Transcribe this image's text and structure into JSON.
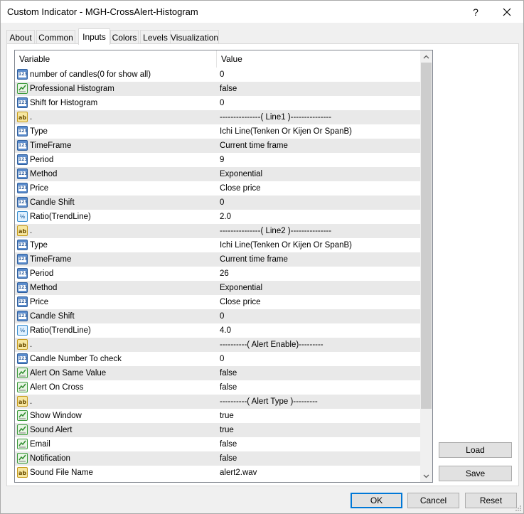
{
  "window": {
    "title": "Custom Indicator - MGH-CrossAlert-Histogram",
    "help_label": "?",
    "icons": {
      "help": "help-icon",
      "close": "close-icon"
    }
  },
  "tabs": [
    {
      "label": "About",
      "active": false
    },
    {
      "label": "Common",
      "active": false
    },
    {
      "label": "Inputs",
      "active": true
    },
    {
      "label": "Colors",
      "active": false
    },
    {
      "label": "Levels",
      "active": false
    },
    {
      "label": "Visualization",
      "active": false
    }
  ],
  "grid": {
    "headers": {
      "variable": "Variable",
      "value": "Value"
    },
    "rows": [
      {
        "type": "num",
        "variable": "number of candles(0 for show all)",
        "value": "0"
      },
      {
        "type": "bool",
        "variable": "Professional Histogram",
        "value": "false"
      },
      {
        "type": "num",
        "variable": "Shift for Histogram",
        "value": "0"
      },
      {
        "type": "str",
        "variable": ".",
        "value": "---------------( Line1 )---------------"
      },
      {
        "type": "num",
        "variable": "Type",
        "value": "Ichi Line(Tenken Or Kijen Or SpanB)"
      },
      {
        "type": "num",
        "variable": "TimeFrame",
        "value": "Current time frame"
      },
      {
        "type": "num",
        "variable": "Period",
        "value": "9"
      },
      {
        "type": "num",
        "variable": "Method",
        "value": "Exponential"
      },
      {
        "type": "num",
        "variable": "Price",
        "value": "Close price"
      },
      {
        "type": "num",
        "variable": "Candle Shift",
        "value": "0"
      },
      {
        "type": "dbl",
        "variable": "Ratio(TrendLine)",
        "value": "2.0"
      },
      {
        "type": "str",
        "variable": ".",
        "value": "---------------( Line2 )---------------"
      },
      {
        "type": "num",
        "variable": "Type",
        "value": "Ichi Line(Tenken Or Kijen Or SpanB)"
      },
      {
        "type": "num",
        "variable": "TimeFrame",
        "value": "Current time frame"
      },
      {
        "type": "num",
        "variable": "Period",
        "value": "26"
      },
      {
        "type": "num",
        "variable": "Method",
        "value": "Exponential"
      },
      {
        "type": "num",
        "variable": "Price",
        "value": "Close price"
      },
      {
        "type": "num",
        "variable": "Candle Shift",
        "value": "0"
      },
      {
        "type": "dbl",
        "variable": "Ratio(TrendLine)",
        "value": "4.0"
      },
      {
        "type": "str",
        "variable": ".",
        "value": "----------( Alert Enable)---------"
      },
      {
        "type": "num",
        "variable": "Candle Number To check",
        "value": "0"
      },
      {
        "type": "bool",
        "variable": "Alert On Same Value",
        "value": "false"
      },
      {
        "type": "bool",
        "variable": "Alert On Cross",
        "value": "false"
      },
      {
        "type": "str",
        "variable": ".",
        "value": "----------( Alert Type )---------"
      },
      {
        "type": "bool",
        "variable": "Show Window",
        "value": "true"
      },
      {
        "type": "bool",
        "variable": "Sound Alert",
        "value": "true"
      },
      {
        "type": "bool",
        "variable": "Email",
        "value": "false"
      },
      {
        "type": "bool",
        "variable": "Notification",
        "value": "false"
      },
      {
        "type": "str",
        "variable": "Sound File Name",
        "value": "alert2.wav"
      }
    ],
    "icon_labels": {
      "num": "123",
      "bool": "",
      "str": "ab",
      "dbl": "½"
    },
    "icon_names": {
      "num": "integer-icon",
      "bool": "boolean-icon",
      "str": "string-icon",
      "dbl": "double-icon"
    }
  },
  "buttons": {
    "load": "Load",
    "save": "Save",
    "ok": "OK",
    "cancel": "Cancel",
    "reset": "Reset"
  },
  "colors": {
    "accent": "#0078d7",
    "row_alt": "#e9e9e9"
  }
}
